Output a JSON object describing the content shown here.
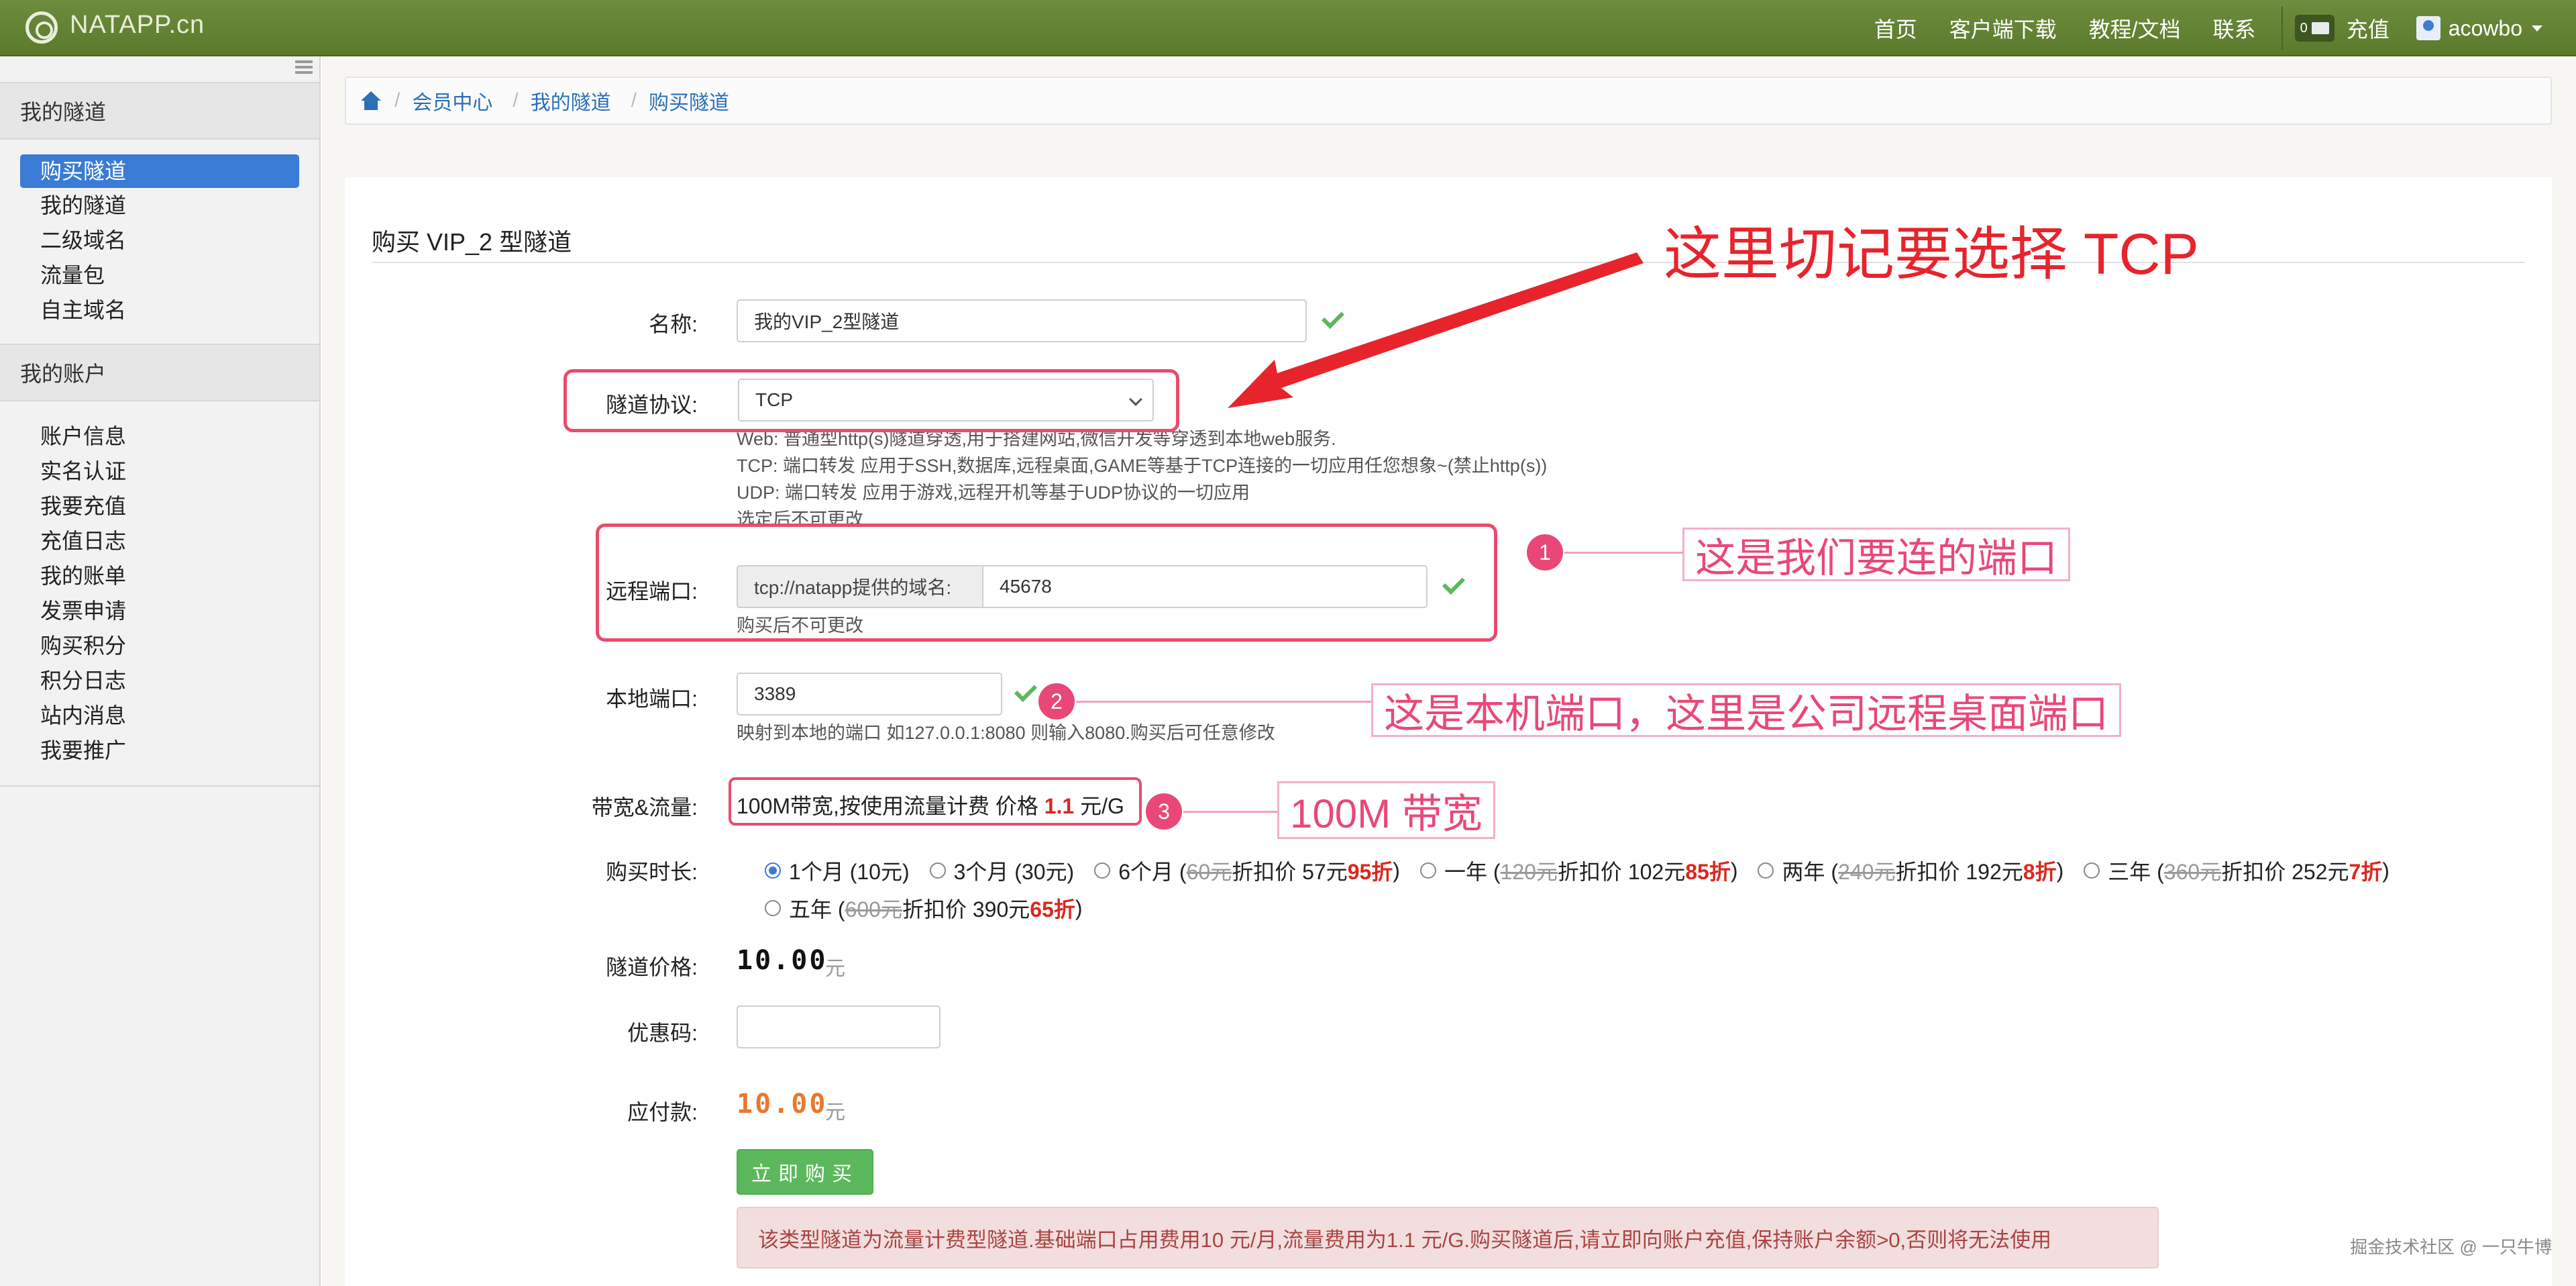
{
  "navbar": {
    "brand": "NATAPP.cn",
    "links": [
      "首页",
      "客户端下载",
      "教程/文档",
      "联系"
    ],
    "message_count": "0",
    "recharge": "充值",
    "username": "acowbo"
  },
  "sidebar": {
    "section1_title": "我的隧道",
    "section1_items": [
      "购买隧道",
      "我的隧道",
      "二级域名",
      "流量包",
      "自主域名"
    ],
    "section2_title": "我的账户",
    "section2_items": [
      "账户信息",
      "实名认证",
      "我要充值",
      "充值日志",
      "我的账单",
      "发票申请",
      "购买积分",
      "积分日志",
      "站内消息",
      "我要推广"
    ]
  },
  "breadcrumb": [
    "会员中心",
    "我的隧道",
    "购买隧道"
  ],
  "form": {
    "title": "购买 VIP_2 型隧道",
    "name_label": "名称:",
    "name_value": "我的VIP_2型隧道",
    "protocol_label": "隧道协议:",
    "protocol_value": "TCP",
    "protocol_help": [
      "Web: 普通型http(s)隧道穿透,用于搭建网站,微信开发等穿透到本地web服务.",
      "TCP: 端口转发 应用于SSH,数据库,远程桌面,GAME等基于TCP连接的一切应用任您想象~(禁止http(s))",
      "UDP: 端口转发 应用于游戏,远程开机等基于UDP协议的一切应用",
      "选定后不可更改"
    ],
    "remote_port_label": "远程端口:",
    "remote_port_prefix": "tcp://natapp提供的域名:",
    "remote_port_value": "45678",
    "remote_port_help": "购买后不可更改",
    "local_port_label": "本地端口:",
    "local_port_value": "3389",
    "local_port_help": "映射到本地的端口 如127.0.0.1:8080 则输入8080.购买后可任意修改",
    "bandwidth_label": "带宽&流量:",
    "bandwidth_text": "100M带宽,按使用流量计费 价格",
    "bandwidth_price": "1.1",
    "bandwidth_unit": "元/G",
    "duration_label": "购买时长:",
    "duration_options": [
      {
        "label": "1个月 (10元)",
        "orig": "",
        "mid": "",
        "disc": "",
        "end": "",
        "selected": true
      },
      {
        "label": "3个月 (30元)",
        "orig": "",
        "mid": "",
        "disc": "",
        "end": "",
        "selected": false
      },
      {
        "label": "6个月 (",
        "orig": "60元",
        "mid": " 折扣价 57元 ",
        "disc": "95折",
        "end": ")",
        "selected": false
      },
      {
        "label": "一年 (",
        "orig": "120元",
        "mid": " 折扣价 102元 ",
        "disc": "85折",
        "end": ")",
        "selected": false
      },
      {
        "label": "两年 (",
        "orig": "240元",
        "mid": " 折扣价 192元 ",
        "disc": "8折",
        "end": ")",
        "selected": false
      },
      {
        "label": "三年 (",
        "orig": "360元",
        "mid": " 折扣价 252元 ",
        "disc": "7折",
        "end": ")",
        "selected": false
      },
      {
        "label": "五年 (",
        "orig": "600元",
        "mid": " 折扣价 390元 ",
        "disc": "65折",
        "end": ")",
        "selected": false
      }
    ],
    "tunnel_price_label": "隧道价格:",
    "tunnel_price": "10.00",
    "price_unit": "元",
    "coupon_label": "优惠码:",
    "coupon_value": "",
    "payable_label": "应付款:",
    "payable": "10.00",
    "buy_button": "立即购买",
    "alert": "该类型隧道为流量计费型隧道.基础端口占用费用10 元/月,流量费用为1.1 元/G.购买隧道后,请立即向账户充值,保持账户余额>0,否则将无法使用"
  },
  "annotations": {
    "title": "这里切记要选择 TCP",
    "note1_num": "1",
    "note1": "这是我们要连的端口",
    "note2_num": "2",
    "note2": "这是本机端口，这里是公司远程桌面端口",
    "note3_num": "3",
    "note3": "100M 带宽"
  },
  "watermark": "掘金技术社区 @ 一只牛博",
  "colors": {
    "navbar": "#6e8c3e",
    "active_item": "#3a7bd5",
    "buy_button": "#5cb85c",
    "annotation": "#e94877",
    "arrow": "#e7242c",
    "payable": "#e8792c"
  }
}
